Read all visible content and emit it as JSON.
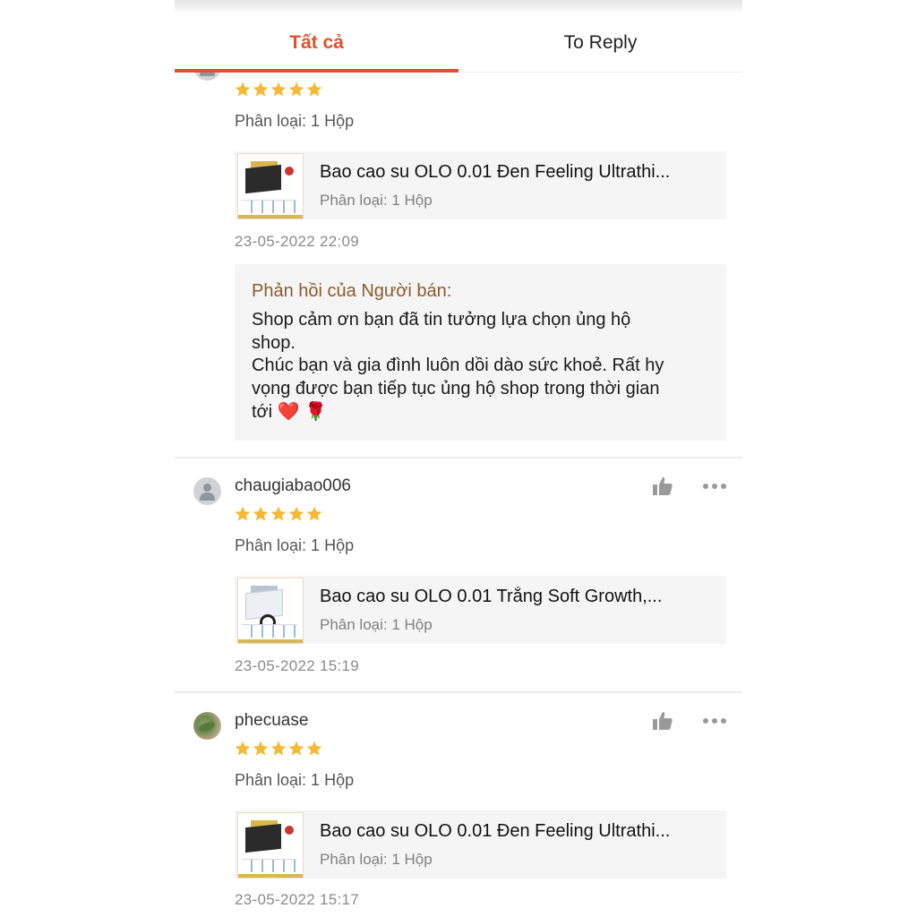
{
  "tabs": [
    {
      "label": "Tất cả",
      "active": true
    },
    {
      "label": "To Reply",
      "active": false
    }
  ],
  "accent_color": "#e0522e",
  "star_color": "#f5b932",
  "reviews": [
    {
      "username": "",
      "stars": 5,
      "variant": "Phân loại: 1 Hộp",
      "product_name": "Bao cao su OLO 0.01 Đen Feeling Ultrathi...",
      "product_variant": "Phân loại: 1 Hộp",
      "timestamp": "23-05-2022 22:09",
      "seller_reply_title": "Phản hồi của Người bán:",
      "seller_reply": "Shop cảm ơn bạn đã tin tưởng lựa chọn ủng hộ\nshop.\nChúc bạn và gia đình luôn dồi dào sức khoẻ. Rất hy\nvọng được bạn tiếp tục ủng hộ shop trong thời gian\ntới ❤️ 🌹"
    },
    {
      "username": "chaugiabao006",
      "stars": 5,
      "variant": "Phân loại: 1 Hộp",
      "product_name": "Bao cao su OLO 0.01 Trắng Soft Growth,...",
      "product_variant": "Phân loại: 1 Hộp",
      "timestamp": "23-05-2022 15:19"
    },
    {
      "username": "phecuase",
      "stars": 5,
      "variant": "Phân loại: 1 Hộp",
      "product_name": "Bao cao su OLO 0.01 Đen Feeling Ultrathi...",
      "product_variant": "Phân loại: 1 Hộp",
      "timestamp": "23-05-2022 15:17"
    }
  ],
  "icons": {
    "like": "thumbs-up-icon",
    "more": "more-horizontal-icon",
    "star": "star-icon",
    "avatar": "default-user-icon"
  }
}
